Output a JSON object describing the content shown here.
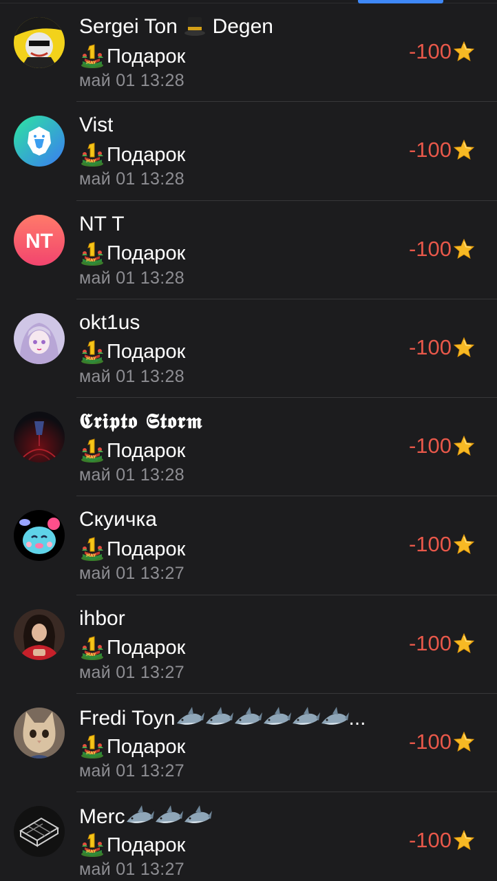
{
  "tab_indicator_color": "#3e88f7",
  "amount_color": "#e8584a",
  "transactions": [
    {
      "name": "Sergei Ton",
      "name_suffix": "Degen",
      "name_emoji": "top-hat-icon",
      "gift_label": "Подарок",
      "gift_icon": "may-gift-icon",
      "time": "май 01 13:28",
      "amount": "-100",
      "currency_icon": "star-icon"
    },
    {
      "name": "Vist",
      "gift_label": "Подарок",
      "gift_icon": "may-gift-icon",
      "time": "май 01 13:28",
      "amount": "-100",
      "currency_icon": "star-icon"
    },
    {
      "name": "NT T",
      "avatar_initials": "NT",
      "gift_label": "Подарок",
      "gift_icon": "may-gift-icon",
      "time": "май 01 13:28",
      "amount": "-100",
      "currency_icon": "star-icon"
    },
    {
      "name": "okt1us",
      "gift_label": "Подарок",
      "gift_icon": "may-gift-icon",
      "time": "май 01 13:28",
      "amount": "-100",
      "currency_icon": "star-icon"
    },
    {
      "name": "𝕮𝖗𝖎𝖕𝖙𝖔 𝕾𝖙𝖔𝖗𝖒",
      "gift_label": "Подарок",
      "gift_icon": "may-gift-icon",
      "time": "май 01 13:28",
      "amount": "-100",
      "currency_icon": "star-icon"
    },
    {
      "name": "Скуичка",
      "gift_label": "Подарок",
      "gift_icon": "may-gift-icon",
      "time": "май 01 13:27",
      "amount": "-100",
      "currency_icon": "star-icon"
    },
    {
      "name": "ihbor",
      "gift_label": "Подарок",
      "gift_icon": "may-gift-icon",
      "time": "май 01 13:27",
      "amount": "-100",
      "currency_icon": "star-icon"
    },
    {
      "name": "Fredi Toyn",
      "name_emoji": "shark-icon",
      "name_emoji_count": 6,
      "name_trailing": "...",
      "gift_label": "Подарок",
      "gift_icon": "may-gift-icon",
      "time": "май 01 13:27",
      "amount": "-100",
      "currency_icon": "star-icon"
    },
    {
      "name": "Merc",
      "name_emoji": "shark-icon",
      "name_emoji_count": 3,
      "gift_label": "Подарок",
      "gift_icon": "may-gift-icon",
      "time": "май 01 13:27",
      "amount": "-100",
      "currency_icon": "star-icon"
    }
  ]
}
